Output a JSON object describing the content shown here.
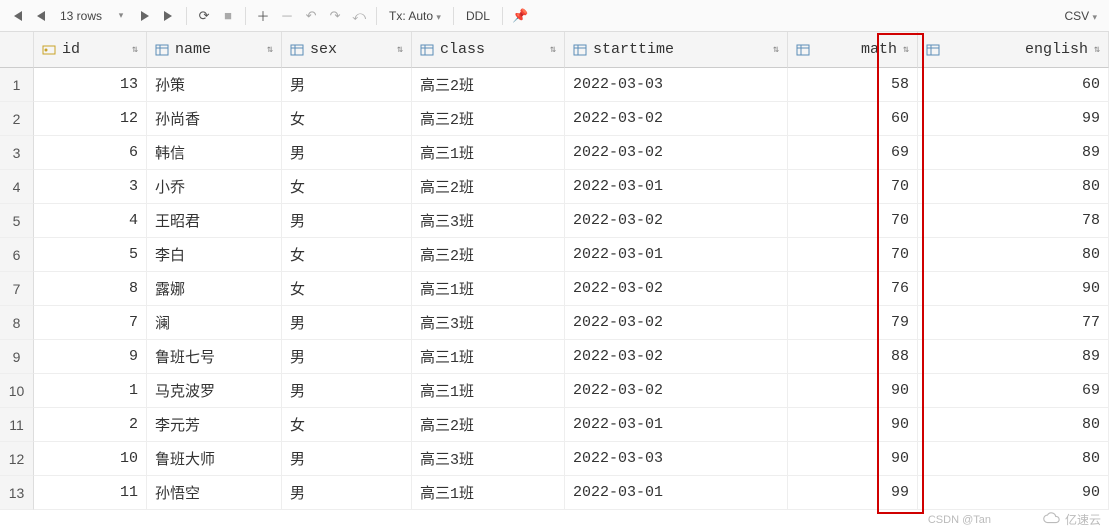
{
  "toolbar": {
    "first_icon": "|◀",
    "prev_icon": "◀",
    "rowcount": "13 rows",
    "dropdown_icon": "▾",
    "next_icon": "▶",
    "last_icon": "▶|",
    "refresh_icon": "⟳",
    "stop_icon": "■",
    "add_icon": "＋",
    "delete_icon": "－",
    "revert_icon": "↶",
    "commit_icon": "↷",
    "rollback_icon": "⤺",
    "tx_label": "Tx: Auto",
    "ddl_label": "DDL",
    "pin_icon": "📌",
    "csv_label": "CSV"
  },
  "columns": {
    "id": "id",
    "name": "name",
    "sex": "sex",
    "class": "class",
    "starttime": "starttime",
    "math": "math",
    "english": "english"
  },
  "rows": [
    {
      "n": "1",
      "id": "13",
      "name": "孙策",
      "sex": "男",
      "class": "高三2班",
      "starttime": "2022-03-03",
      "math": "58",
      "english": "60"
    },
    {
      "n": "2",
      "id": "12",
      "name": "孙尚香",
      "sex": "女",
      "class": "高三2班",
      "starttime": "2022-03-02",
      "math": "60",
      "english": "99"
    },
    {
      "n": "3",
      "id": "6",
      "name": "韩信",
      "sex": "男",
      "class": "高三1班",
      "starttime": "2022-03-02",
      "math": "69",
      "english": "89"
    },
    {
      "n": "4",
      "id": "3",
      "name": "小乔",
      "sex": "女",
      "class": "高三2班",
      "starttime": "2022-03-01",
      "math": "70",
      "english": "80"
    },
    {
      "n": "5",
      "id": "4",
      "name": "王昭君",
      "sex": "男",
      "class": "高三3班",
      "starttime": "2022-03-02",
      "math": "70",
      "english": "78"
    },
    {
      "n": "6",
      "id": "5",
      "name": "李白",
      "sex": "女",
      "class": "高三2班",
      "starttime": "2022-03-01",
      "math": "70",
      "english": "80"
    },
    {
      "n": "7",
      "id": "8",
      "name": "露娜",
      "sex": "女",
      "class": "高三1班",
      "starttime": "2022-03-02",
      "math": "76",
      "english": "90"
    },
    {
      "n": "8",
      "id": "7",
      "name": "澜",
      "sex": "男",
      "class": "高三3班",
      "starttime": "2022-03-02",
      "math": "79",
      "english": "77"
    },
    {
      "n": "9",
      "id": "9",
      "name": "鲁班七号",
      "sex": "男",
      "class": "高三1班",
      "starttime": "2022-03-02",
      "math": "88",
      "english": "89"
    },
    {
      "n": "10",
      "id": "1",
      "name": "马克波罗",
      "sex": "男",
      "class": "高三1班",
      "starttime": "2022-03-02",
      "math": "90",
      "english": "69"
    },
    {
      "n": "11",
      "id": "2",
      "name": "李元芳",
      "sex": "女",
      "class": "高三2班",
      "starttime": "2022-03-01",
      "math": "90",
      "english": "80"
    },
    {
      "n": "12",
      "id": "10",
      "name": "鲁班大师",
      "sex": "男",
      "class": "高三3班",
      "starttime": "2022-03-03",
      "math": "90",
      "english": "80"
    },
    {
      "n": "13",
      "id": "11",
      "name": "孙悟空",
      "sex": "男",
      "class": "高三1班",
      "starttime": "2022-03-01",
      "math": "99",
      "english": "90"
    }
  ],
  "watermark": {
    "csdn": "CSDN @Tan",
    "yisu": "亿速云"
  }
}
